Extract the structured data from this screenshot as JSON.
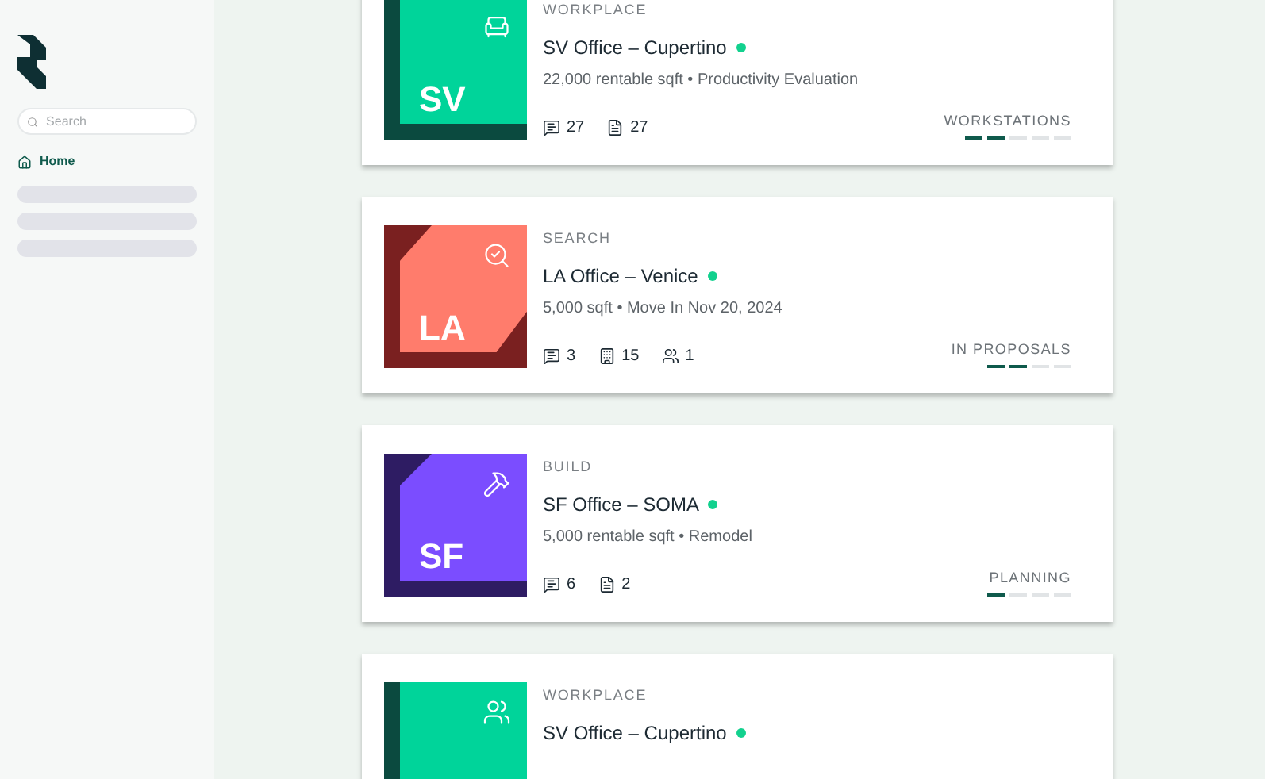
{
  "sidebar": {
    "search": {
      "placeholder": "Search"
    },
    "nav": [
      {
        "label": "Home",
        "selected": true
      }
    ]
  },
  "projects": [
    {
      "category": "WORKPLACE",
      "title": "SV Office – Cupertino",
      "active": true,
      "details": "22,000 rentable sqft • Productivity Evaluation",
      "tile": {
        "kind": "workplace",
        "initials": "SV"
      },
      "stats": [
        {
          "kind": "comments",
          "value": "27"
        },
        {
          "kind": "documents",
          "value": "27"
        }
      ],
      "stage": {
        "label": "WORKSTATIONS",
        "steps": [
          true,
          true,
          false,
          false,
          false
        ]
      }
    },
    {
      "category": "SEARCH",
      "title": "LA Office – Venice",
      "active": true,
      "details": "5,000 sqft • Move In Nov 20, 2024",
      "tile": {
        "kind": "search",
        "initials": "LA"
      },
      "stats": [
        {
          "kind": "comments",
          "value": "3"
        },
        {
          "kind": "buildings",
          "value": "15"
        },
        {
          "kind": "tours",
          "value": "1"
        }
      ],
      "stage": {
        "label": "IN PROPOSALS",
        "steps": [
          true,
          true,
          false,
          false
        ]
      }
    },
    {
      "category": "BUILD",
      "title": "SF Office – SOMA",
      "active": true,
      "details": "5,000 rentable sqft • Remodel",
      "tile": {
        "kind": "build",
        "initials": "SF"
      },
      "stats": [
        {
          "kind": "comments",
          "value": "6"
        },
        {
          "kind": "documents",
          "value": "2"
        }
      ],
      "stage": {
        "label": "PLANNING",
        "steps": [
          true,
          false,
          false,
          false
        ]
      }
    },
    {
      "category": "WORKPLACE",
      "title": "SV Office – Cupertino",
      "active": true,
      "tile": {
        "kind": "workplace"
      }
    }
  ]
}
